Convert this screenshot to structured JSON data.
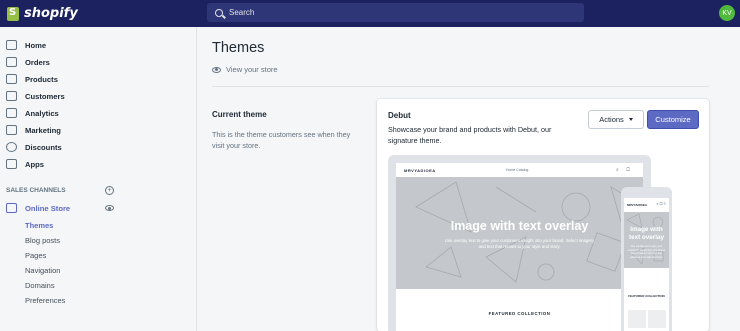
{
  "brand": {
    "name": "shopify"
  },
  "search": {
    "placeholder": "Search"
  },
  "user": {
    "initials": "KV"
  },
  "sidebar": {
    "items": [
      {
        "label": "Home",
        "icon": "home-icon"
      },
      {
        "label": "Orders",
        "icon": "orders-icon"
      },
      {
        "label": "Products",
        "icon": "tag-icon"
      },
      {
        "label": "Customers",
        "icon": "person-icon"
      },
      {
        "label": "Analytics",
        "icon": "bar-chart-icon"
      },
      {
        "label": "Marketing",
        "icon": "megaphone-icon"
      },
      {
        "label": "Discounts",
        "icon": "discount-icon"
      },
      {
        "label": "Apps",
        "icon": "apps-grid-icon"
      }
    ],
    "sales_channels_title": "SALES CHANNELS",
    "online_store": "Online Store",
    "sub_items": [
      "Themes",
      "Blog posts",
      "Pages",
      "Navigation",
      "Domains",
      "Preferences"
    ]
  },
  "main": {
    "title": "Themes",
    "view_store": "View your store",
    "current_theme_title": "Current theme",
    "current_theme_desc": "This is the theme customers see when they visit your store.",
    "theme": {
      "name": "Debut",
      "description": "Showcase your brand and products with Debut, our signature theme.",
      "actions_label": "Actions",
      "customize_label": "Customize"
    },
    "preview": {
      "store_logo": "MRVYADIOEA",
      "nav_links": "Home  Catalog",
      "hero_title": "Image with text overlay",
      "hero_sub": "Use overlay text to give your customers insight into your brand. Select imagery and text that relates to your style and story.",
      "featured": "FEATURED COLLECTION"
    }
  },
  "colors": {
    "topbar": "#1c2260",
    "accent": "#5c6ac4",
    "brand_green": "#95bf47",
    "avatar": "#50b83c"
  }
}
